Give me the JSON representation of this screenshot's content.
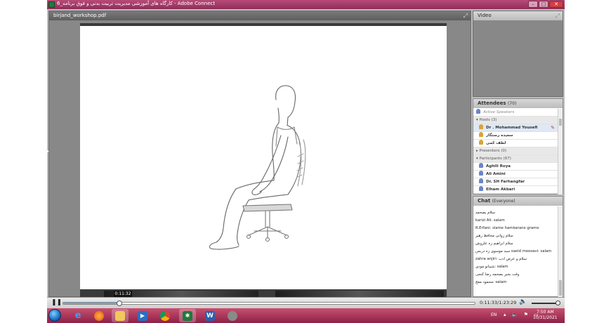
{
  "window": {
    "title": "کارگاه های آموزشی مدیریت تربیت بدنی و فوق برنامه_6 - Adobe Connect"
  },
  "share_pod": {
    "title": "birjand_workshop.pdf",
    "timestamp_tooltip": "0:11:32"
  },
  "video_pod": {
    "title": "Video"
  },
  "attendees": {
    "title": "Attendees",
    "count": "(70)",
    "active_speakers": "Active Speakers",
    "hosts_label": "Hosts (3)",
    "hosts": [
      "Dr . Mohammad Yousefi",
      "سعیده رستگار",
      "لطف کمی"
    ],
    "presenters_label": "Presenters (0)",
    "participants_label": "Participants (67)",
    "participants": [
      "Aghili Roya",
      "Ali Amini",
      "Dr. SH Farhangfar",
      "Elham Akbari"
    ]
  },
  "chat": {
    "title": "Chat",
    "scope": "(Everyone)",
    "messages": [
      "سلام بصحمد",
      "karizi Ali: salam",
      "R.Erfani: slame hamkarane grame",
      "سلام زوانی محافظ رهبر",
      "سلام ابراهیم زه علروش",
      "سید موسوی زه دربس saeid moosavi: salam",
      "zahra anjiri: سلام و عرض ادب",
      "شیبانو مودی: salam",
      "وقت بخیر بصحمد رضا کنجی",
      "محمود معج: salam"
    ]
  },
  "playback": {
    "time": "0:11:33/1:23:29",
    "progress": 0.138,
    "volume": 0.95
  },
  "taskbar": {
    "language": "EN",
    "time": "7:50 AM",
    "date": "10/31/2021"
  },
  "colors": {
    "taskbar": "#b03a61",
    "title_bar": "#a3406b",
    "pod_background": "#888888"
  }
}
